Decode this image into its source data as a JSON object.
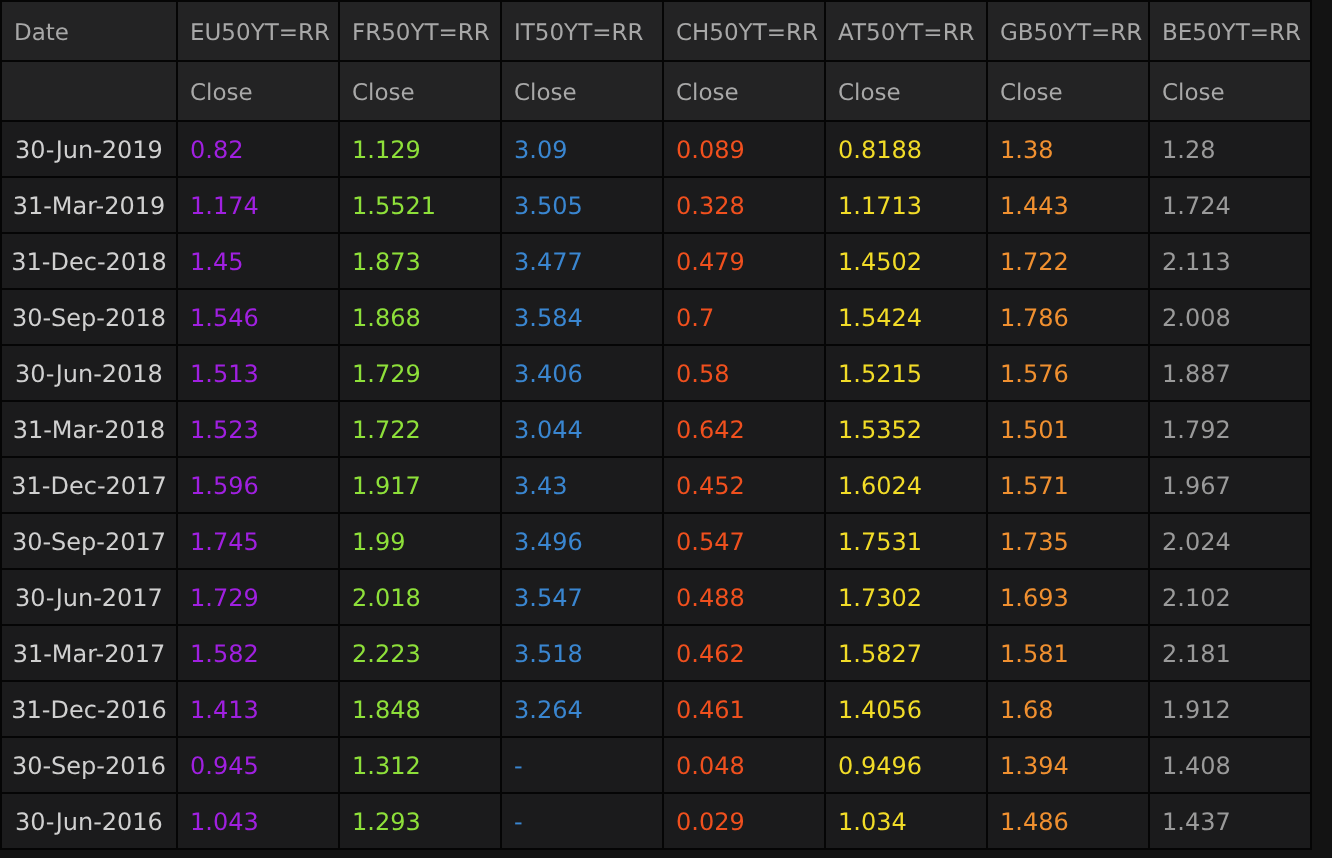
{
  "table": {
    "date_column": {
      "label": "Date"
    },
    "columns": [
      {
        "label": "EU50YT=RR",
        "subheader": "Close",
        "color": "#a020e0"
      },
      {
        "label": "FR50YT=RR",
        "subheader": "Close",
        "color": "#8ee03a"
      },
      {
        "label": "IT50YT=RR",
        "subheader": "Close",
        "color": "#3a86d0"
      },
      {
        "label": "CH50YT=RR",
        "subheader": "Close",
        "color": "#f0501e"
      },
      {
        "label": "AT50YT=RR",
        "subheader": "Close",
        "color": "#f2dc28"
      },
      {
        "label": "GB50YT=RR",
        "subheader": "Close",
        "color": "#f09030"
      },
      {
        "label": "BE50YT=RR",
        "subheader": "Close",
        "color": "#9a9a9a"
      }
    ],
    "rows": [
      {
        "date": "30-Jun-2019",
        "values": [
          "0.82",
          "1.129",
          "3.09",
          "0.089",
          "0.8188",
          "1.38",
          "1.28"
        ]
      },
      {
        "date": "31-Mar-2019",
        "values": [
          "1.174",
          "1.5521",
          "3.505",
          "0.328",
          "1.1713",
          "1.443",
          "1.724"
        ]
      },
      {
        "date": "31-Dec-2018",
        "values": [
          "1.45",
          "1.873",
          "3.477",
          "0.479",
          "1.4502",
          "1.722",
          "2.113"
        ]
      },
      {
        "date": "30-Sep-2018",
        "values": [
          "1.546",
          "1.868",
          "3.584",
          "0.7",
          "1.5424",
          "1.786",
          "2.008"
        ]
      },
      {
        "date": "30-Jun-2018",
        "values": [
          "1.513",
          "1.729",
          "3.406",
          "0.58",
          "1.5215",
          "1.576",
          "1.887"
        ]
      },
      {
        "date": "31-Mar-2018",
        "values": [
          "1.523",
          "1.722",
          "3.044",
          "0.642",
          "1.5352",
          "1.501",
          "1.792"
        ]
      },
      {
        "date": "31-Dec-2017",
        "values": [
          "1.596",
          "1.917",
          "3.43",
          "0.452",
          "1.6024",
          "1.571",
          "1.967"
        ]
      },
      {
        "date": "30-Sep-2017",
        "values": [
          "1.745",
          "1.99",
          "3.496",
          "0.547",
          "1.7531",
          "1.735",
          "2.024"
        ]
      },
      {
        "date": "30-Jun-2017",
        "values": [
          "1.729",
          "2.018",
          "3.547",
          "0.488",
          "1.7302",
          "1.693",
          "2.102"
        ]
      },
      {
        "date": "31-Mar-2017",
        "values": [
          "1.582",
          "2.223",
          "3.518",
          "0.462",
          "1.5827",
          "1.581",
          "2.181"
        ]
      },
      {
        "date": "31-Dec-2016",
        "values": [
          "1.413",
          "1.848",
          "3.264",
          "0.461",
          "1.4056",
          "1.68",
          "1.912"
        ]
      },
      {
        "date": "30-Sep-2016",
        "values": [
          "0.945",
          "1.312",
          "-",
          "0.048",
          "0.9496",
          "1.394",
          "1.408"
        ]
      },
      {
        "date": "30-Jun-2016",
        "values": [
          "1.043",
          "1.293",
          "-",
          "0.029",
          "1.034",
          "1.486",
          "1.437"
        ]
      }
    ]
  }
}
